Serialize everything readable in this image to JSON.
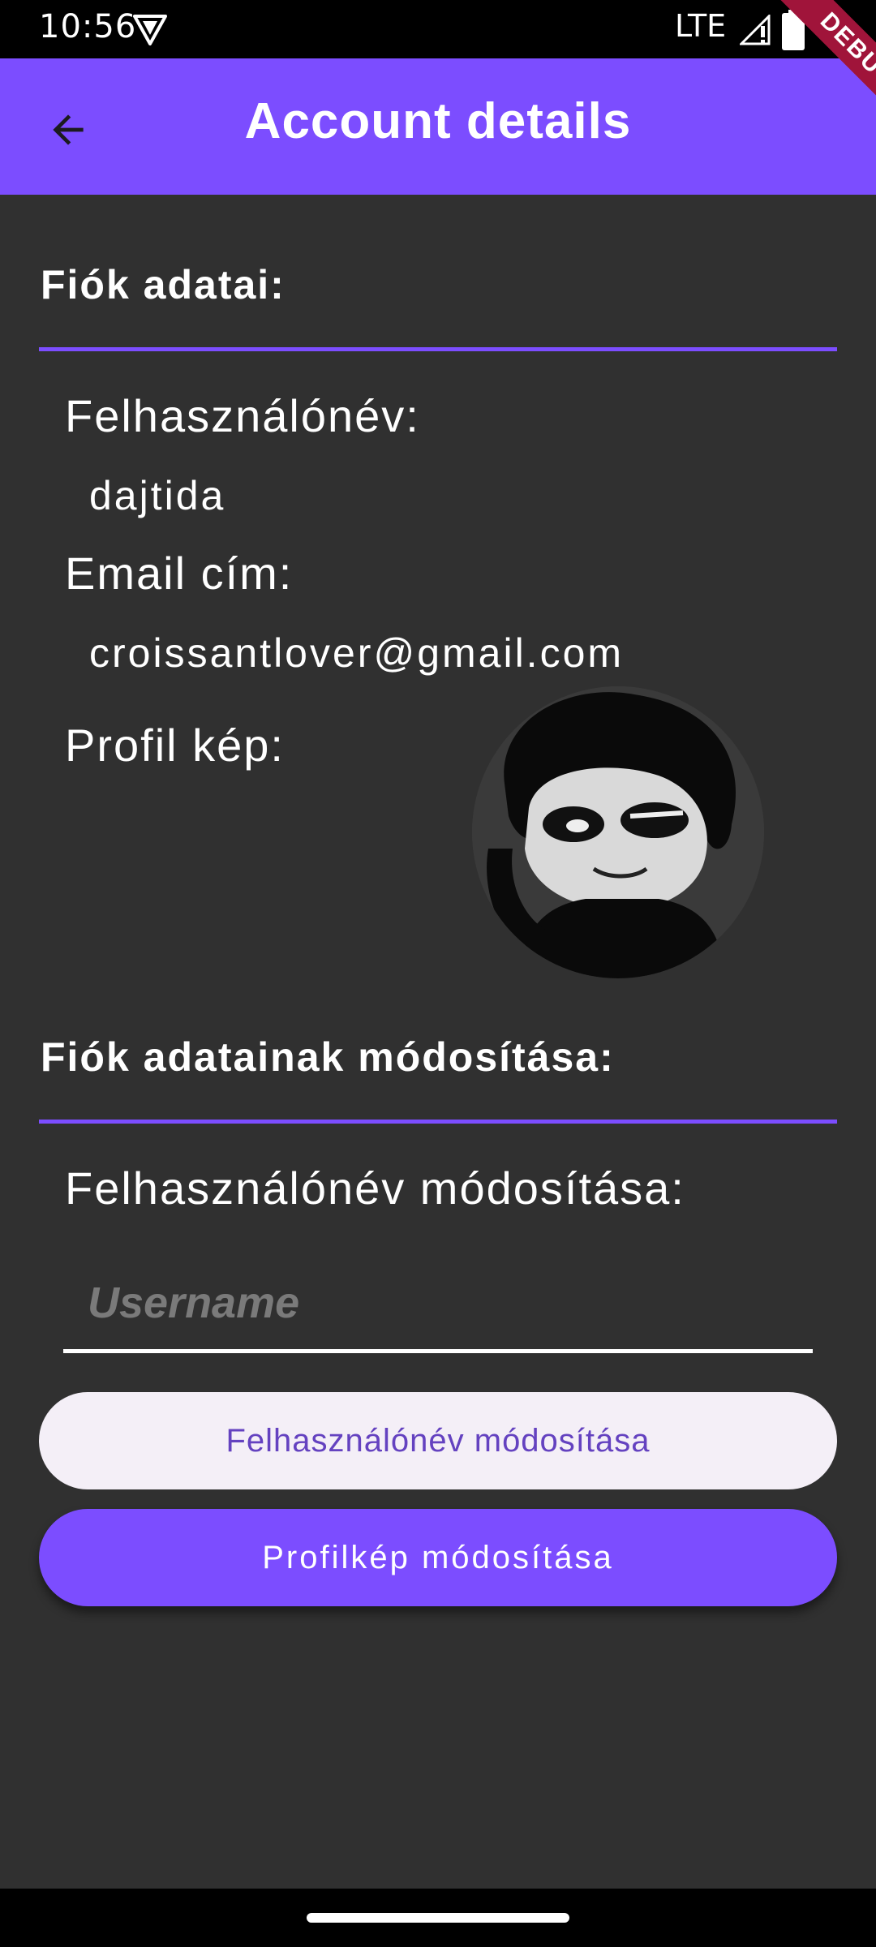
{
  "status_bar": {
    "time": "10:56",
    "network": "LTE",
    "icons": [
      "vpn-icon",
      "signal-icon",
      "battery-icon"
    ]
  },
  "debug_banner": "DEBUG",
  "app_bar": {
    "title": "Account details",
    "back_icon": "arrow-back-icon",
    "color": "#7c4dff"
  },
  "account_info": {
    "heading": "Fiók adatai:",
    "username_label": "Felhasználónév:",
    "username_value": "dajtida",
    "email_label": "Email cím:",
    "email_value": "croissantlover@gmail.com",
    "avatar_label": "Profil kép:"
  },
  "account_edit": {
    "heading": "Fiók adatainak módosítása:",
    "username_change_label": "Felhasználónév módosítása:",
    "username_placeholder": "Username",
    "change_username_button": "Felhasználónév módosítása",
    "change_avatar_button": "Profilkép módosítása"
  },
  "colors": {
    "accent": "#7c4dff",
    "background": "#303030",
    "light_button": "#f4eff7",
    "light_button_text": "#6442c0"
  }
}
